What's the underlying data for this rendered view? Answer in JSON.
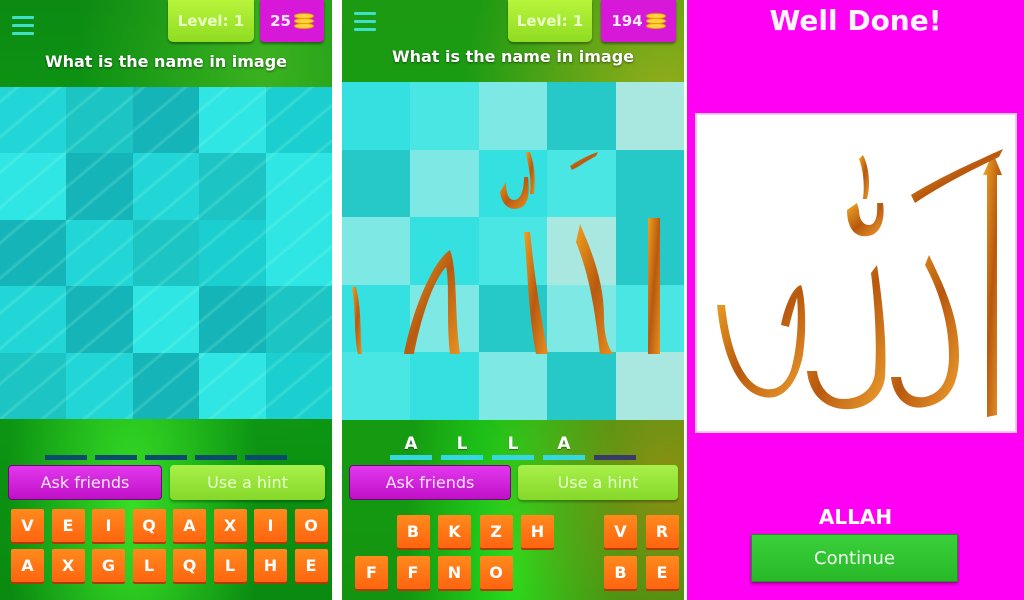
{
  "screens": [
    {
      "header": {
        "level_label": "Level: 1",
        "coins": "25",
        "coin_icon": "coins-stack-icon",
        "menu_icon": "hamburger-menu-icon"
      },
      "question": "What is the name in image",
      "revealed_tiles": [],
      "answer_slots": [
        "",
        "",
        "",
        "",
        ""
      ],
      "buttons": {
        "ask_friends": "Ask friends",
        "use_hint": "Use a hint"
      },
      "keyboard": {
        "row1": [
          "V",
          "E",
          "I",
          "Q",
          "A",
          "X",
          "I",
          "O"
        ],
        "row2": [
          "A",
          "X",
          "G",
          "L",
          "Q",
          "L",
          "H",
          "E"
        ]
      }
    },
    {
      "header": {
        "level_label": "Level: 1",
        "coins": "194",
        "coin_icon": "coins-stack-icon",
        "menu_icon": "hamburger-menu-icon"
      },
      "question": "What is the name in image",
      "revealed_tiles": [
        7,
        8,
        11,
        12,
        13,
        14,
        15,
        16,
        17,
        18,
        19
      ],
      "answer_slots": [
        "A",
        "L",
        "L",
        "A",
        ""
      ],
      "buttons": {
        "ask_friends": "Ask friends",
        "use_hint": "Use a hint"
      },
      "keyboard": {
        "row1": [
          "",
          "B",
          "K",
          "Z",
          "H",
          "",
          "V",
          "R"
        ],
        "row2": [
          "F",
          "F",
          "N",
          "O",
          "",
          "",
          "B",
          "E"
        ]
      }
    },
    {
      "title": "Well Done!",
      "answer": "ALLAH",
      "continue_label": "Continue",
      "image_description": "Arabic calligraphy of the word Allah in gold glitter"
    }
  ],
  "colors": {
    "background_green": "#0fa016",
    "level_badge": "#a8ec34",
    "coin_badge": "#d818d8",
    "ask_button": "#d020dc",
    "hint_button": "#98e43a",
    "key_orange": "#ff7416",
    "tile_cyan": "#22d6d8",
    "success_magenta": "#ff00f4",
    "continue_green": "#30c430"
  }
}
